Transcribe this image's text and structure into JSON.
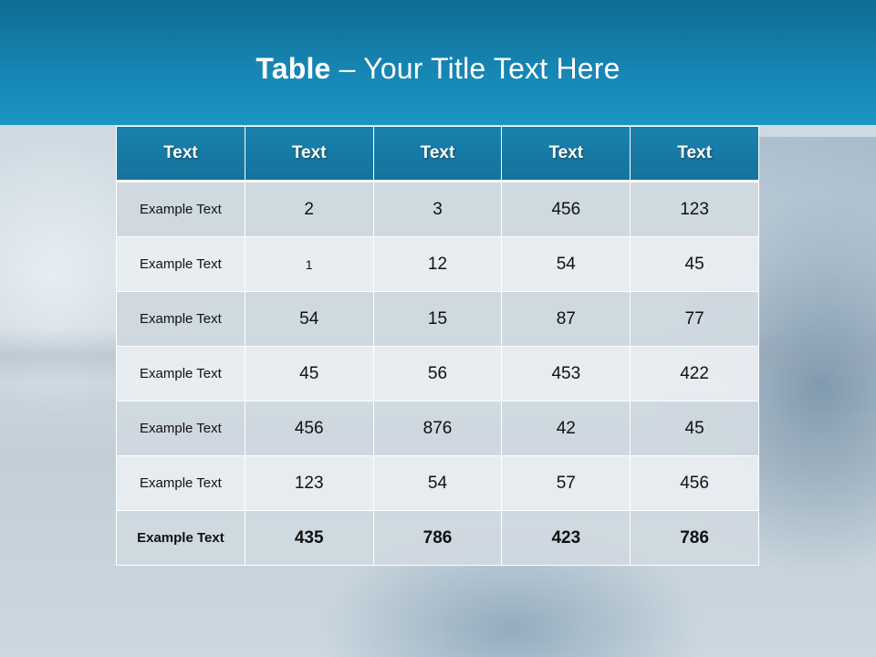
{
  "slide": {
    "title_bold": "Table",
    "title_rest": " – Your Title Text Here"
  },
  "table": {
    "headers": [
      "Text",
      "Text",
      "Text",
      "Text",
      "Text"
    ],
    "rows": [
      [
        "Example Text",
        "2",
        "3",
        "456",
        "123"
      ],
      [
        "Example Text",
        "1",
        "12",
        "54",
        "45"
      ],
      [
        "Example Text",
        "54",
        "15",
        "87",
        "77"
      ],
      [
        "Example Text",
        "45",
        "56",
        "453",
        "422"
      ],
      [
        "Example Text",
        "456",
        "876",
        "42",
        "45"
      ],
      [
        "Example Text",
        "123",
        "54",
        "57",
        "456"
      ],
      [
        "Example Text",
        "435",
        "786",
        "423",
        "786"
      ]
    ]
  },
  "colors": {
    "header_band": "#1787b5",
    "table_header": "#14739c",
    "row_dark": "#cfd8e0",
    "row_light": "#e8edf1"
  }
}
